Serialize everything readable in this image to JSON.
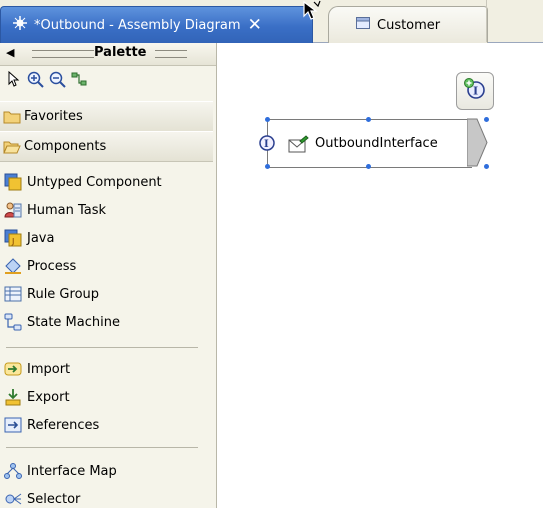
{
  "tabs": [
    {
      "label": "*Outbound - Assembly Diagram",
      "close": "✕",
      "icon": "assembly-diagram-icon",
      "active": true
    },
    {
      "label": "Customer",
      "icon": "business-object-icon",
      "active": false
    }
  ],
  "palette": {
    "title": "Palette",
    "collapse_arrow": "◀",
    "tools": [
      "select-arrow-icon",
      "zoom-in-icon",
      "zoom-out-icon",
      "wire-icon"
    ],
    "drawers": [
      {
        "label": "Favorites",
        "icon": "folder-icon"
      },
      {
        "label": "Components",
        "icon": "folder-open-icon"
      }
    ],
    "items": [
      {
        "label": "Untyped Component",
        "icon": "untyped-component-icon"
      },
      {
        "label": "Human Task",
        "icon": "human-task-icon"
      },
      {
        "label": "Java",
        "icon": "java-component-icon"
      },
      {
        "label": "Process",
        "icon": "process-icon"
      },
      {
        "label": "Rule Group",
        "icon": "rule-group-icon"
      },
      {
        "label": "State Machine",
        "icon": "state-machine-icon"
      },
      {
        "label": "Import",
        "icon": "import-icon"
      },
      {
        "label": "Export",
        "icon": "export-icon"
      },
      {
        "label": "References",
        "icon": "references-icon"
      },
      {
        "label": "Interface Map",
        "icon": "interface-map-icon"
      },
      {
        "label": "Selector",
        "icon": "selector-icon"
      }
    ]
  },
  "canvas": {
    "node": {
      "label": "OutboundInterface",
      "icon": "interface-icon"
    },
    "hover_button": "add-interface-icon"
  },
  "colors": {
    "accent": "#3a6fc6",
    "selection": "#2f6edc",
    "palette_bg": "#f5f4ea"
  }
}
